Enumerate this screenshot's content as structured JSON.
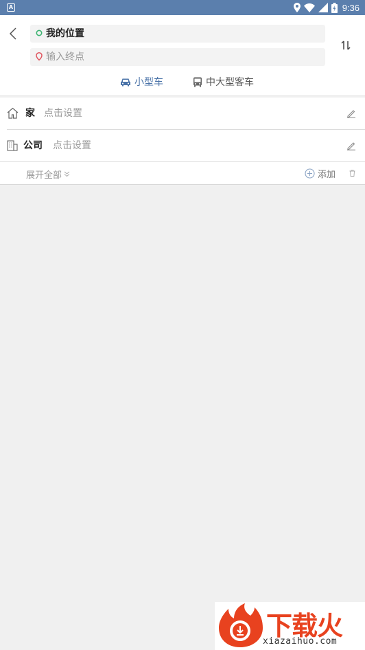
{
  "status_bar": {
    "time": "9:36",
    "app_icon_label": "A"
  },
  "route": {
    "start": "我的位置",
    "end_placeholder": "输入终点",
    "modes": [
      {
        "label": "小型车",
        "selected": true
      },
      {
        "label": "中大型客车",
        "selected": false
      }
    ]
  },
  "places": {
    "home": {
      "label": "家",
      "action": "点击设置"
    },
    "office": {
      "label": "公司",
      "action": "点击设置"
    },
    "expand_label": "展开全部",
    "add_label": "添加"
  },
  "watermark": {
    "brand": "下载火",
    "url": "xiazaihuo.com"
  },
  "colors": {
    "status_bar": "#5b7fad",
    "accent": "#4a73a8",
    "start_dot": "#3cb371",
    "end_pin": "#e0555f",
    "brand": "#e8421f"
  }
}
